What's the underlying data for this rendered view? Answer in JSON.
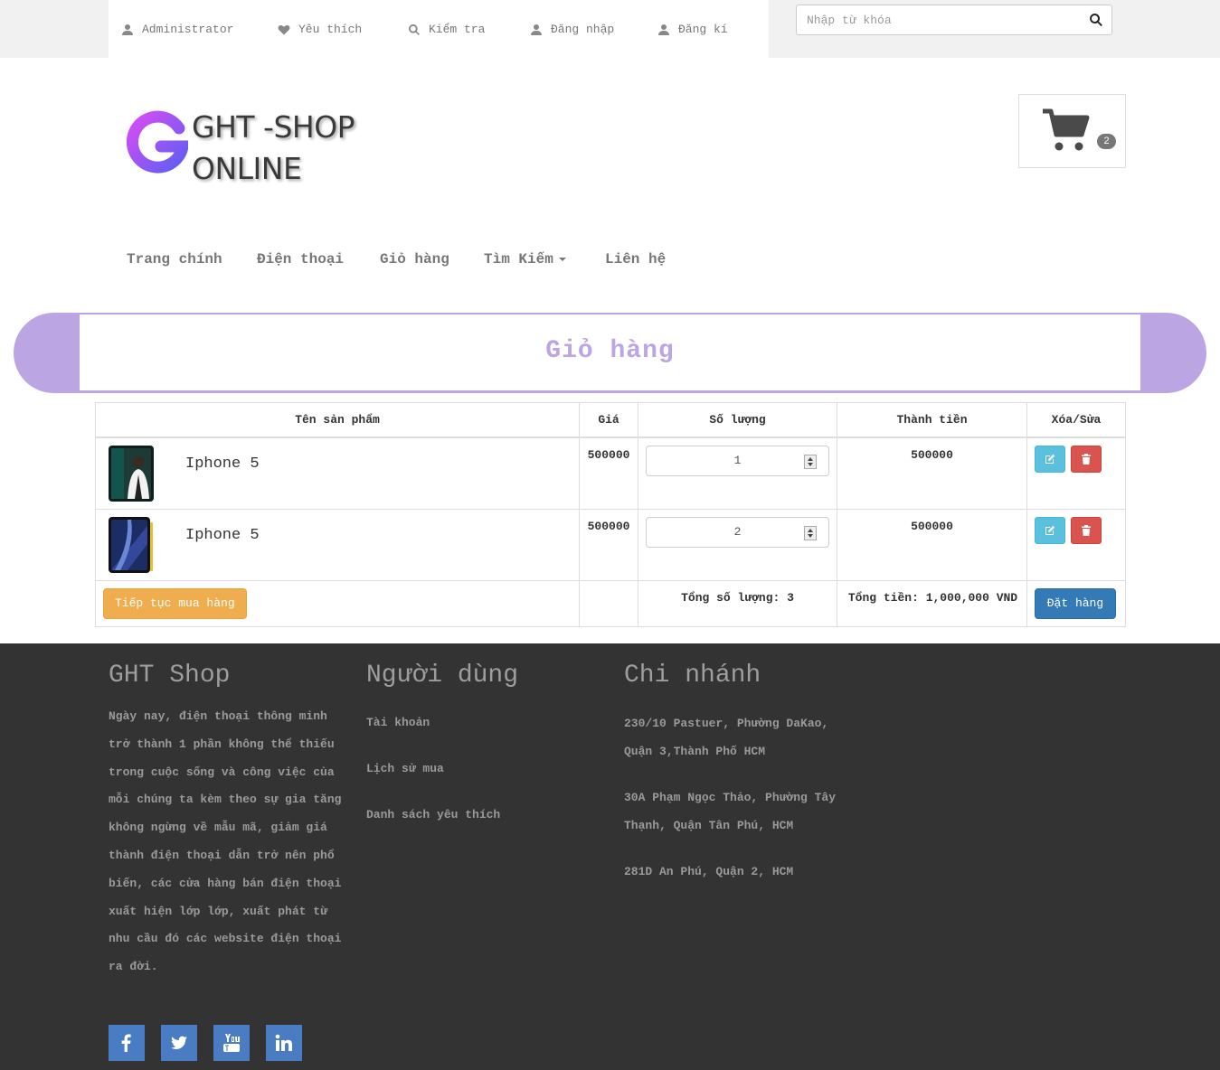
{
  "topbar": {
    "links": [
      {
        "label": "Administrator",
        "icon": "user-icon"
      },
      {
        "label": "Yêu thích",
        "icon": "heart-icon"
      },
      {
        "label": "Kiểm tra",
        "icon": "search-icon"
      },
      {
        "label": "Đăng nhập",
        "icon": "user-icon"
      },
      {
        "label": "Đăng kí",
        "icon": "user-icon"
      }
    ],
    "search_placeholder": "Nhập từ khóa"
  },
  "logo": {
    "line1": "GHT -SHOP",
    "line2": "ONLINE",
    "gradient": [
      "#c643fc",
      "#6a5cf5"
    ]
  },
  "cart": {
    "count": "2"
  },
  "nav": {
    "items": [
      "Trang chính",
      "Điện thoại",
      "Giỏ hàng",
      "Tìm Kiếm",
      "Liên hệ"
    ]
  },
  "page_title": "Giỏ hàng",
  "table": {
    "headers": [
      "Tên sản phẩm",
      "Giá",
      "Số lượng",
      "Thành tiền",
      "Xóa/Sửa"
    ],
    "rows": [
      {
        "name": "Iphone 5",
        "price": "500000",
        "qty": "1",
        "subtotal": "500000"
      },
      {
        "name": "Iphone 5",
        "price": "500000",
        "qty": "2",
        "subtotal": "500000"
      }
    ],
    "continue_label": "Tiếp tục mua hàng",
    "total_qty": "Tổng số lượng: 3",
    "total_price": "Tổng tiền: 1,000,000 VND",
    "order_label": "Đặt hàng"
  },
  "footer": {
    "col1_title": "GHT Shop",
    "col1_text": "Ngày nay, điện thoại thông minh trở thành 1 phần không thể thiếu trong cuộc sống và công việc của mỗi chúng ta kèm theo sự gia tăng không ngừng về mẫu mã, giảm giá thành điện thoại dẫn trở nên phổ biến, các cửa hàng bán điện thoại xuất hiện lớp lớp, xuất phát từ nhu cầu đó các website điện thoại ra đời.",
    "col2_title": "Người dùng",
    "col2_links": [
      "Tài khoản",
      "Lịch sử mua",
      "Danh sách yêu thích"
    ],
    "col3_title": "Chi nhánh",
    "col3_addresses": [
      "230/10 Pastuer, Phường DaKao, Quận 3,Thành Phố HCM",
      "30A Phạm Ngọc Thảo, Phường Tây Thạnh, Quận Tân Phú, HCM",
      "281D An Phú, Quận 2, HCM"
    ],
    "social": [
      "facebook-icon",
      "twitter-icon",
      "youtube-icon",
      "linkedin-icon"
    ]
  },
  "colors": {
    "accent": "#bba6e3",
    "footer_bg": "#333333",
    "social": "#4a7cc4"
  }
}
